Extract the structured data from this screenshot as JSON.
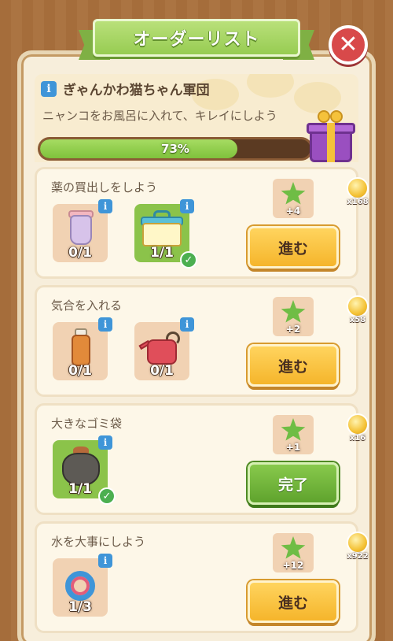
{
  "title": "オーダーリスト",
  "close_icon": "close-icon",
  "group": {
    "name": "ぎゃんかわ猫ちゃん軍団",
    "description": "ニャンコをお風呂に入れて、キレイにしよう",
    "progress_percent": 73,
    "progress_label": "73%",
    "reward_icon": "gift-box-icon"
  },
  "orders": [
    {
      "title": "薬の買出しをしよう",
      "items": [
        {
          "icon": "protein-shaker-icon",
          "count": "0/1",
          "done": false
        },
        {
          "icon": "first-aid-kit-icon",
          "count": "1/1",
          "done": true
        }
      ],
      "reward": {
        "icon": "green-star-icon",
        "label": "+4"
      },
      "coin": {
        "icon": "coin-icon",
        "label": "x168"
      },
      "button": "進む",
      "button_state": "go"
    },
    {
      "title": "気合を入れる",
      "items": [
        {
          "icon": "energy-drink-icon",
          "count": "0/1",
          "done": false
        },
        {
          "icon": "watering-can-icon",
          "count": "0/1",
          "done": false
        }
      ],
      "reward": {
        "icon": "green-star-icon",
        "label": "+2"
      },
      "coin": {
        "icon": "coin-icon",
        "label": "x58"
      },
      "button": "進む",
      "button_state": "go"
    },
    {
      "title": "大きなゴミ袋",
      "items": [
        {
          "icon": "garbage-bag-icon",
          "count": "1/1",
          "done": true
        }
      ],
      "reward": {
        "icon": "green-star-icon",
        "label": "+1"
      },
      "coin": {
        "icon": "coin-icon",
        "label": "x16"
      },
      "button": "完了",
      "button_state": "done"
    },
    {
      "title": "水を大事にしよう",
      "items": [
        {
          "icon": "hose-reel-icon",
          "count": "1/3",
          "done": false
        }
      ],
      "reward": {
        "icon": "green-star-icon",
        "label": "+12"
      },
      "coin": {
        "icon": "coin-icon",
        "label": "x922"
      },
      "button": "進む",
      "button_state": "go"
    }
  ],
  "colors": {
    "accent_green": "#97cc52",
    "button_yellow": "#f5b52b",
    "close_red": "#d8494a",
    "info_blue": "#3f95d8"
  }
}
